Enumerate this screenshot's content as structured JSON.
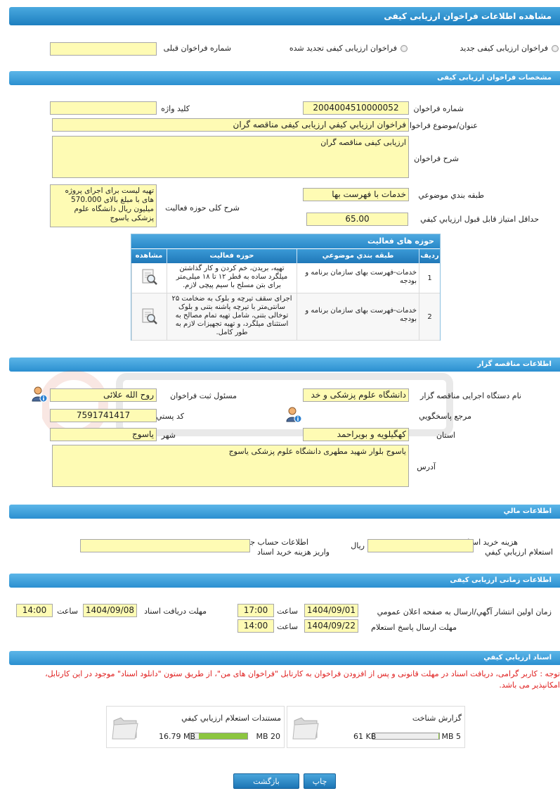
{
  "page": {
    "title": "مشاهده اطلاعات فراخوان ارزيابی کيفی"
  },
  "type_options": {
    "new": "فراخوان ارزيابی کيفی جديد",
    "renewed": "فراخوان ارزيابی کيفی تجديد شده",
    "previous_number_label": "شماره فراخوان قبلی",
    "previous_number_value": ""
  },
  "spec": {
    "header": "مشخصات فراخوان ارزيابی کيفی",
    "number_label": "شماره فراخوان",
    "number_value": "2004004510000052",
    "keyword_label": "کليد واژه",
    "keyword_value": "",
    "subject_label": "عنوان/موضوع فراخوان",
    "subject_value": "فراخوان ارزيابي كيفي ارزيابی کیفی مناقصه گران",
    "description_label": "شرح فراخوان",
    "description_value": "ارزیابی کیفی مناقصه گران",
    "category_label": "طبقه بندي موضوعي",
    "category_value": "خدمات با فهرست بها",
    "activity_desc_label": "شرح کلی حوزه فعالیت",
    "activity_desc_value": "تهیه لیست برای اجرای پروژه های با مبلغ بالای 570.000 میلیون ریال دانشگاه علوم پزشکی یاسوج",
    "min_score_label": "حداقل امتياز قابل قبول ارزيابي كيفي",
    "min_score_value": "65.00"
  },
  "activity_table": {
    "title": "حوزه های فعالیت",
    "headers": [
      "ردیف",
      "طبقه بندي موضوعي",
      "حوزه فعالیت",
      "مشاهده"
    ],
    "rows": [
      {
        "index": "1",
        "category": "خدمات-فهرست بهای سازمان برنامه و بودجه",
        "activity": "تهیه، بریدن، خم کردن و کار گذاشتن میلگرد ساده به قطر ۱۲ تا ۱۸ میلی‌متر برای بتن مسلح با سیم پیچی لازم."
      },
      {
        "index": "2",
        "category": "خدمات-فهرست بهای سازمان برنامه و بودجه",
        "activity": "اجرای سقف تیرچه و بلوک به ضخامت ۲۵ سانتی‌متر با تیرچه پاشنه بتنی و بلوک توخالی بتنی، شامل تهیه تمام مصالح به استثنای میلگرد، و تهیه تجهیزات لازم به طور کامل."
      }
    ]
  },
  "organizer": {
    "header": "اطلاعات مناقصه گزار",
    "org_label": "نام دستگاه اجرایی مناقصه گزار",
    "org_value": "دانشگاه علوم پزشکی و خد",
    "responsible_label": "مسئول ثبت فراخوان",
    "responsible_value": "روح الله علائی",
    "reference_label": "مرجع پاسخگويي",
    "postal_label": "کد پستي",
    "postal_value": "7591741417",
    "province_label": "استان",
    "province_value": "کهگیلویه و بویراحمد",
    "city_label": "شهر",
    "city_value": "یاسوج",
    "address_label": "آدرس",
    "address_value": "یاسوج بلوار شهید مطهری دانشگاه علوم پزشکی یاسوج"
  },
  "financial": {
    "header": "اطلاعات مالي",
    "cost_label_1": "هزينه خريد اسناد",
    "cost_label_2": "استعلام ارزيابي کيفي",
    "cost_value": "",
    "currency": "ريال",
    "account_label_1": "اطلاعات حساب جهت",
    "account_label_2": "واريز هزينه خريد اسناد",
    "account_value": ""
  },
  "timing": {
    "header": "اطلاعات زمانی ارزيابی کيفی",
    "publish_label": "زمان اولين انتشار آگهي/ارسال به صفحه اعلان عمومي",
    "publish_date": "1404/09/01",
    "publish_time": "17:00",
    "receive_label": "مهلت دريافت اسناد",
    "receive_date": "1404/09/08",
    "receive_time": "14:00",
    "reply_label": "مهلت ارسال پاسخ استعلام",
    "reply_date": "1404/09/22",
    "reply_time": "14:00",
    "time_label": "ساعت"
  },
  "documents": {
    "header": "اسناد ارزيابي كيفي",
    "notice": "توجه : کاربر گرامی، دریافت اسناد در مهلت قانونی و پس از افزودن فراخوان به کارتابل \"فراخوان های من\"، از طریق ستون \"دانلود اسناد\" موجود در این کارتابل، امکانپذیر می باشد.",
    "files": [
      {
        "name": "گزارش شناخت",
        "size": "61 KB",
        "max": "5 MB",
        "fill": 0.012
      },
      {
        "name": "مستندات استعلام ارزيابي کيفي",
        "size": "16.79 MB",
        "max": "20 MB",
        "fill": 0.84
      }
    ]
  },
  "actions": {
    "print": "چاپ",
    "back": "بازگشت"
  },
  "colors": {
    "header_blue": "#2b8fd0",
    "field_yellow": "#fefbb4",
    "warning_red": "#e02020",
    "progress_green": "#8cc63f"
  }
}
